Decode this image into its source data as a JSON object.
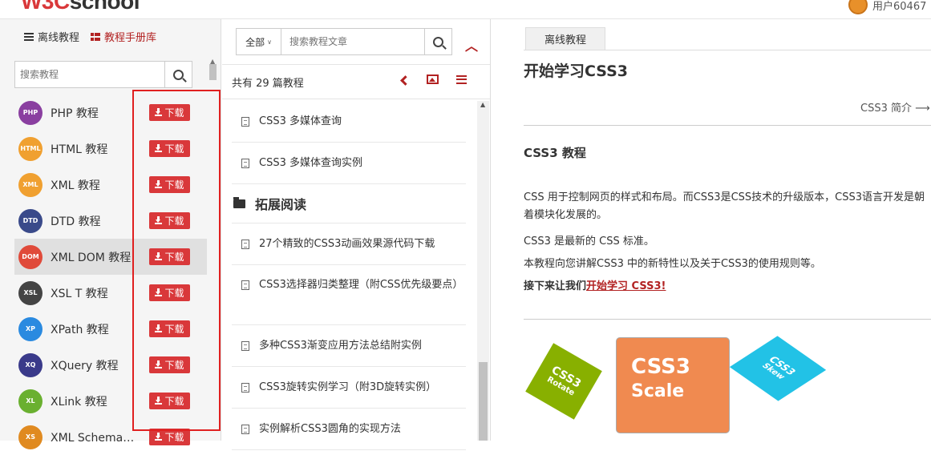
{
  "header": {
    "logo_w3c": "W3C",
    "logo_school": "school",
    "user_label": "用户60467"
  },
  "left": {
    "tabs": [
      {
        "label": "离线教程"
      },
      {
        "label": "教程手册库"
      }
    ],
    "search_placeholder": "搜索教程",
    "download_label": "下载",
    "courses": [
      {
        "name": "PHP 教程",
        "color": "#8a3fa0",
        "icon_text": "PHP"
      },
      {
        "name": "HTML 教程",
        "color": "#f0a030",
        "icon_text": "HTML"
      },
      {
        "name": "XML 教程",
        "color": "#f0a030",
        "icon_text": "XML"
      },
      {
        "name": "DTD 教程",
        "color": "#3a4a8a",
        "icon_text": "DTD"
      },
      {
        "name": "XML DOM 教程",
        "color": "#e04a3a",
        "icon_text": "DOM"
      },
      {
        "name": "XSL T 教程",
        "color": "#444444",
        "icon_text": "XSL"
      },
      {
        "name": "XPath 教程",
        "color": "#2a8ae0",
        "icon_text": "XP"
      },
      {
        "name": "XQuery 教程",
        "color": "#3a3a8a",
        "icon_text": "XQ"
      },
      {
        "name": "XLink 教程",
        "color": "#6ab030",
        "icon_text": "XL"
      },
      {
        "name": "XML Schema 教程",
        "color": "#e08a20",
        "icon_text": "XS"
      }
    ]
  },
  "middle": {
    "select_label": "全部",
    "search_placeholder": "搜索教程文章",
    "count_text": "共有 29 篇教程",
    "articles_top": [
      {
        "title": "CSS3 多媒体查询"
      },
      {
        "title": "CSS3 多媒体查询实例"
      }
    ],
    "section_title": "拓展阅读",
    "articles_ext": [
      {
        "title": "27个精致的CSS3动画效果源代码下载"
      },
      {
        "title": "CSS3选择器归类整理（附CSS优先级要点）"
      },
      {
        "title": "多种CSS3渐变应用方法总结附实例"
      },
      {
        "title": "CSS3旋转实例学习（附3D旋转实例）"
      },
      {
        "title": "实例解析CSS3圆角的实现方法"
      }
    ]
  },
  "content": {
    "tab_label": "离线教程",
    "title": "开始学习CSS3",
    "next_link": "CSS3 简介 ⟶",
    "h2": "CSS3 教程",
    "p1": "CSS 用于控制网页的样式和布局。而CSS3是CSS技术的升级版本，CSS3语言开发是朝着模块化发展的。",
    "p2": "CSS3 是最新的 CSS 标准。",
    "p3": "本教程向您讲解CSS3 中的新特性以及关于CSS3的使用规则等。",
    "p4_prefix": "接下来让我们",
    "p4_link": "开始学习 CSS3!",
    "image": {
      "rotate_a": "CSS3",
      "rotate_b": "Rotate",
      "scale_a": "CSS3",
      "scale_b": "Scale",
      "skew_a": "CSS3",
      "skew_b": "Skew"
    }
  }
}
